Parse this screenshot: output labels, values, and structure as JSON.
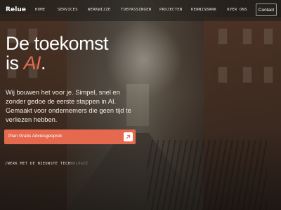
{
  "header": {
    "logo": "Relue",
    "nav": [
      {
        "label": "HOME"
      },
      {
        "label": "SERVICES"
      },
      {
        "label": "WERKWIJZE"
      },
      {
        "label": "TOEPASSINGEN"
      },
      {
        "label": "PROJECTEN"
      },
      {
        "label": "KENNISBANK"
      },
      {
        "label": "OVER ONS"
      }
    ],
    "contact_label": "Contact"
  },
  "hero": {
    "title_line1": "De toekomst",
    "title_is": "is ",
    "title_accent": "AI",
    "title_period": ".",
    "subtitle": "Wij bouwen het voor je. Simpel, snel en zonder gedoe de eerste stappen in AI. Gemaakt voor ondernemers die geen tijd te verliezen hebben.",
    "cta_label": "Plan Gratis Adviesgesprek",
    "tagline": "/WERK MET DE NIEUWSTE TECH",
    "tagline_fade": "NOLOGIE"
  },
  "colors": {
    "accent": "#e5694f",
    "text": "#ffffff"
  },
  "icons": {
    "cta_icon": "arrow-up-right-icon"
  }
}
